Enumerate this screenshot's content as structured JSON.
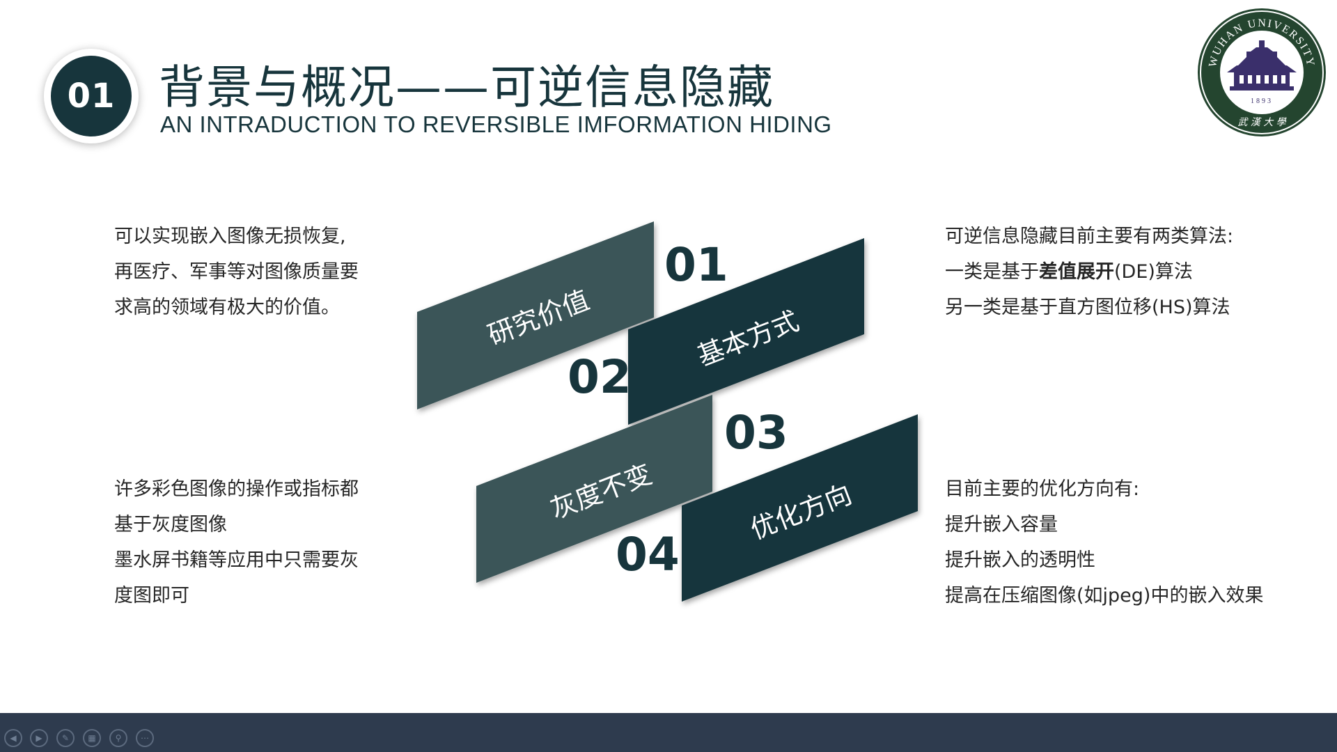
{
  "header": {
    "number": "01",
    "title": "背景与概况——可逆信息隐藏",
    "subtitle": "AN INTRADUCTION TO REVERSIBLE IMFORMATION HIDING"
  },
  "logo": {
    "text": "WUHAN UNIVERSITY",
    "year": "1893",
    "icon": "wuhan-university-seal-icon"
  },
  "left_top": {
    "lines": [
      "可以实现嵌入图像无损恢复,",
      "再医疗、军事等对图像质量要",
      "求高的领域有极大的价值。"
    ]
  },
  "left_bottom": {
    "lines": [
      "许多彩色图像的操作或指标都",
      "基于灰度图像",
      "墨水屏书籍等应用中只需要灰",
      "度图即可"
    ]
  },
  "right_top": {
    "line1": "可逆信息隐藏目前主要有两类算法:",
    "line2_pre": "一类是基于",
    "line2_bold": "差值展开",
    "line2_post": "(DE)算法",
    "line3": "另一类是基于直方图位移(HS)算法"
  },
  "right_bottom": {
    "lines": [
      "目前主要的优化方向有:",
      "提升嵌入容量",
      "提升嵌入的透明性",
      "提高在压缩图像(如jpeg)中的嵌入效果"
    ]
  },
  "diagram": {
    "items": [
      {
        "number": "01",
        "label": "研究价值"
      },
      {
        "number": "02",
        "label": "基本方式"
      },
      {
        "number": "03",
        "label": "灰度不变"
      },
      {
        "number": "04",
        "label": "优化方向"
      }
    ],
    "colors": {
      "light": "#3b5558",
      "dark": "#17353c"
    }
  },
  "toolbar": {
    "buttons": [
      {
        "icon": "previous-icon",
        "glyph": "◀"
      },
      {
        "icon": "next-icon",
        "glyph": "▶"
      },
      {
        "icon": "pen-icon",
        "glyph": "✎"
      },
      {
        "icon": "slides-grid-icon",
        "glyph": "▦"
      },
      {
        "icon": "zoom-icon",
        "glyph": "⚲"
      },
      {
        "icon": "more-options-icon",
        "glyph": "⋯"
      }
    ]
  }
}
